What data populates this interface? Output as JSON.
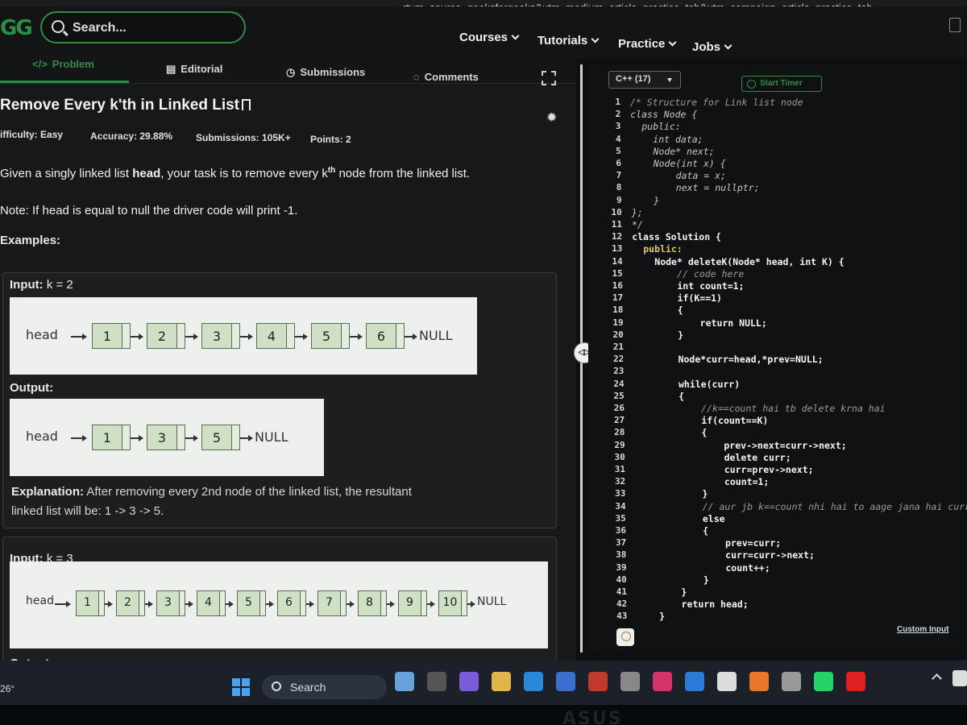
{
  "browser": {
    "url": "rtum_source=geeksforgeeks&utm_medium=article_practice_tab&utm_campaign=article_practice_tab"
  },
  "header": {
    "logo": "GG",
    "search_placeholder": "Search...",
    "menu": [
      "Courses",
      "Tutorials",
      "Practice",
      "Jobs"
    ]
  },
  "tabs": [
    "Problem",
    "Editorial",
    "Submissions",
    "Comments"
  ],
  "problem": {
    "title": "Remove Every k'th in Linked List",
    "difficulty_label": "ifficulty:",
    "difficulty": "Easy",
    "accuracy_label": "Accuracy:",
    "accuracy": "29.88%",
    "submissions_label": "Submissions:",
    "submissions": "105K+",
    "points_label": "Points:",
    "points": "2",
    "description_pre": "Given a singly linked list ",
    "description_bold": "head",
    "description_mid": ",  your task is to remove every k",
    "description_sup": "th",
    "description_post": " node from the linked list.",
    "note": "Note: If head is equal to null the driver code will print -1.",
    "examples_heading": "Examples:"
  },
  "example1": {
    "input_label": "Input:",
    "input_value": " k = 2",
    "input_list": [
      "1",
      "2",
      "3",
      "4",
      "5",
      "6"
    ],
    "output_label": "Output:",
    "output_list": [
      "1",
      "3",
      "5"
    ],
    "head_label": "head",
    "null_label": "NULL",
    "explanation_label": "Explanation:",
    "explanation_text": " After removing every 2nd node of the linked list, the resultant",
    "explanation_text2": "linked list will be: 1 -> 3 -> 5."
  },
  "example2": {
    "input_label": "Input:",
    "input_value": " k = 3",
    "input_list": [
      "1",
      "2",
      "3",
      "4",
      "5",
      "6",
      "7",
      "8",
      "9",
      "10"
    ],
    "output_label": "Output:",
    "head_label": "head",
    "null_label": "NULL"
  },
  "editor": {
    "language": "C++ (17)",
    "timer_label": "Start Timer",
    "custom_input": "Custom Input",
    "lines": [
      {
        "n": "1",
        "t": "/* Structure for Link list node",
        "s": "comment"
      },
      {
        "n": "2",
        "t": "class Node {",
        "s": "norm"
      },
      {
        "n": "3",
        "t": "  public:",
        "s": "norm"
      },
      {
        "n": "4",
        "t": "    int data;",
        "s": "norm"
      },
      {
        "n": "5",
        "t": "    Node* next;",
        "s": "norm"
      },
      {
        "n": "6",
        "t": "    Node(int x) {",
        "s": "norm"
      },
      {
        "n": "7",
        "t": "        data = x;",
        "s": "norm"
      },
      {
        "n": "8",
        "t": "        next = nullptr;",
        "s": "norm"
      },
      {
        "n": "9",
        "t": "    }",
        "s": "norm"
      },
      {
        "n": "10",
        "t": "};",
        "s": "norm"
      },
      {
        "n": "11",
        "t": "*/",
        "s": "norm"
      },
      {
        "n": "12",
        "t": "class Solution {",
        "s": "bold"
      },
      {
        "n": "13",
        "t": "  public:",
        "s": "kw"
      },
      {
        "n": "14",
        "t": "    Node* deleteK(Node* head, int K) {",
        "s": "bold"
      },
      {
        "n": "15",
        "t": "        // code here",
        "s": "comment"
      },
      {
        "n": "16",
        "t": "        int count=1;",
        "s": "bold"
      },
      {
        "n": "17",
        "t": "        if(K==1)",
        "s": "bold"
      },
      {
        "n": "18",
        "t": "        {",
        "s": "bold"
      },
      {
        "n": "19",
        "t": "            return NULL;",
        "s": "bold"
      },
      {
        "n": "20",
        "t": "        }",
        "s": "bold"
      },
      {
        "n": "21",
        "t": "",
        "s": "bold"
      },
      {
        "n": "22",
        "t": "        Node*curr=head,*prev=NULL;",
        "s": "bold"
      },
      {
        "n": "23",
        "t": "",
        "s": "bold"
      },
      {
        "n": "24",
        "t": "        while(curr)",
        "s": "bold"
      },
      {
        "n": "25",
        "t": "        {",
        "s": "bold"
      },
      {
        "n": "26",
        "t": "            //k==count hai tb delete krna hai",
        "s": "comment"
      },
      {
        "n": "27",
        "t": "            if(count==K)",
        "s": "bold"
      },
      {
        "n": "28",
        "t": "            {",
        "s": "bold"
      },
      {
        "n": "29",
        "t": "                prev->next=curr->next;",
        "s": "bold"
      },
      {
        "n": "30",
        "t": "                delete curr;",
        "s": "bold"
      },
      {
        "n": "31",
        "t": "                curr=prev->next;",
        "s": "bold"
      },
      {
        "n": "32",
        "t": "                count=1;",
        "s": "bold"
      },
      {
        "n": "33",
        "t": "            }",
        "s": "bold"
      },
      {
        "n": "34",
        "t": "            // aur jb k==count nhi hai to aage jana hai curr a",
        "s": "comment"
      },
      {
        "n": "35",
        "t": "            else",
        "s": "bold"
      },
      {
        "n": "36",
        "t": "            {",
        "s": "bold"
      },
      {
        "n": "37",
        "t": "                prev=curr;",
        "s": "bold"
      },
      {
        "n": "38",
        "t": "                curr=curr->next;",
        "s": "bold"
      },
      {
        "n": "39",
        "t": "                count++;",
        "s": "bold"
      },
      {
        "n": "40",
        "t": "            }",
        "s": "bold"
      },
      {
        "n": "41",
        "t": "        }",
        "s": "bold"
      },
      {
        "n": "42",
        "t": "        return head;",
        "s": "bold"
      },
      {
        "n": "43",
        "t": "    }",
        "s": "bold"
      }
    ]
  },
  "taskbar": {
    "temperature": "26°",
    "search_label": "Search",
    "apps": [
      "widgets",
      "task-view",
      "copilot",
      "file-explorer",
      "edge",
      "store",
      "mcafee",
      "calendar",
      "instagram",
      "vscode",
      "chatgpt",
      "firefox",
      "camera",
      "whatsapp",
      "youtube"
    ]
  },
  "device_brand": "ASUS",
  "colors": {
    "accent": "#2f8d46",
    "keyword": "#e6c84a",
    "number": "#ff6b6b"
  }
}
